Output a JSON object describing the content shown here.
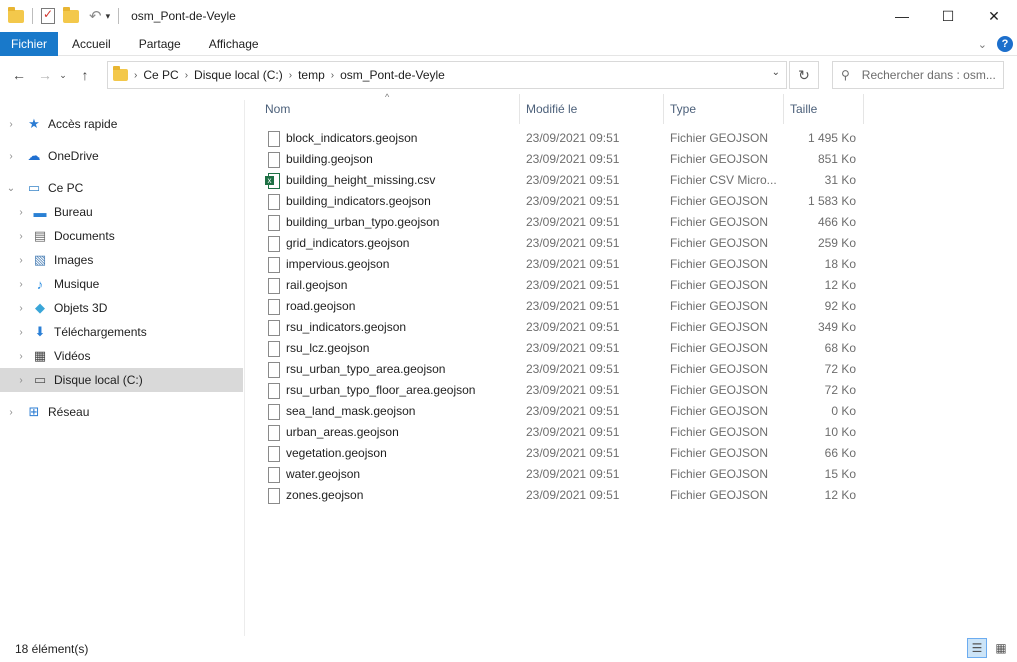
{
  "window": {
    "title": "osm_Pont-de-Veyle",
    "minimize": "—",
    "maximize": "☐",
    "close": "✕"
  },
  "ribbon": {
    "tabs": [
      "Fichier",
      "Accueil",
      "Partage",
      "Affichage"
    ],
    "help": "?"
  },
  "address": {
    "crumbs": [
      "Ce PC",
      "Disque local (C:)",
      "temp",
      "osm_Pont-de-Veyle"
    ],
    "search_placeholder": "Rechercher dans : osm..."
  },
  "nav": [
    {
      "label": "Accès rapide",
      "icon": "star-icon",
      "level": 0
    },
    {
      "label": "OneDrive",
      "icon": "cloud-icon",
      "level": 0
    },
    {
      "label": "Ce PC",
      "icon": "computer-icon",
      "level": 0,
      "expanded": true
    },
    {
      "label": "Bureau",
      "icon": "desktop-icon",
      "level": 1
    },
    {
      "label": "Documents",
      "icon": "documents-icon",
      "level": 1
    },
    {
      "label": "Images",
      "icon": "images-icon",
      "level": 1
    },
    {
      "label": "Musique",
      "icon": "music-icon",
      "level": 1
    },
    {
      "label": "Objets 3D",
      "icon": "cube-icon",
      "level": 1
    },
    {
      "label": "Téléchargements",
      "icon": "download-icon",
      "level": 1
    },
    {
      "label": "Vidéos",
      "icon": "video-icon",
      "level": 1
    },
    {
      "label": "Disque local (C:)",
      "icon": "drive-icon",
      "level": 1,
      "selected": true
    },
    {
      "label": "Réseau",
      "icon": "network-icon",
      "level": 0
    }
  ],
  "columns": {
    "name": "Nom",
    "modified": "Modifié le",
    "type": "Type",
    "size": "Taille"
  },
  "files": [
    {
      "name": "block_indicators.geojson",
      "modified": "23/09/2021 09:51",
      "type": "Fichier GEOJSON",
      "size": "1 495 Ko",
      "kind": "file"
    },
    {
      "name": "building.geojson",
      "modified": "23/09/2021 09:51",
      "type": "Fichier GEOJSON",
      "size": "851 Ko",
      "kind": "file"
    },
    {
      "name": "building_height_missing.csv",
      "modified": "23/09/2021 09:51",
      "type": "Fichier CSV Micro...",
      "size": "31 Ko",
      "kind": "csv"
    },
    {
      "name": "building_indicators.geojson",
      "modified": "23/09/2021 09:51",
      "type": "Fichier GEOJSON",
      "size": "1 583 Ko",
      "kind": "file"
    },
    {
      "name": "building_urban_typo.geojson",
      "modified": "23/09/2021 09:51",
      "type": "Fichier GEOJSON",
      "size": "466 Ko",
      "kind": "file"
    },
    {
      "name": "grid_indicators.geojson",
      "modified": "23/09/2021 09:51",
      "type": "Fichier GEOJSON",
      "size": "259 Ko",
      "kind": "file"
    },
    {
      "name": "impervious.geojson",
      "modified": "23/09/2021 09:51",
      "type": "Fichier GEOJSON",
      "size": "18 Ko",
      "kind": "file"
    },
    {
      "name": "rail.geojson",
      "modified": "23/09/2021 09:51",
      "type": "Fichier GEOJSON",
      "size": "12 Ko",
      "kind": "file"
    },
    {
      "name": "road.geojson",
      "modified": "23/09/2021 09:51",
      "type": "Fichier GEOJSON",
      "size": "92 Ko",
      "kind": "file"
    },
    {
      "name": "rsu_indicators.geojson",
      "modified": "23/09/2021 09:51",
      "type": "Fichier GEOJSON",
      "size": "349 Ko",
      "kind": "file"
    },
    {
      "name": "rsu_lcz.geojson",
      "modified": "23/09/2021 09:51",
      "type": "Fichier GEOJSON",
      "size": "68 Ko",
      "kind": "file"
    },
    {
      "name": "rsu_urban_typo_area.geojson",
      "modified": "23/09/2021 09:51",
      "type": "Fichier GEOJSON",
      "size": "72 Ko",
      "kind": "file"
    },
    {
      "name": "rsu_urban_typo_floor_area.geojson",
      "modified": "23/09/2021 09:51",
      "type": "Fichier GEOJSON",
      "size": "72 Ko",
      "kind": "file"
    },
    {
      "name": "sea_land_mask.geojson",
      "modified": "23/09/2021 09:51",
      "type": "Fichier GEOJSON",
      "size": "0 Ko",
      "kind": "file"
    },
    {
      "name": "urban_areas.geojson",
      "modified": "23/09/2021 09:51",
      "type": "Fichier GEOJSON",
      "size": "10 Ko",
      "kind": "file"
    },
    {
      "name": "vegetation.geojson",
      "modified": "23/09/2021 09:51",
      "type": "Fichier GEOJSON",
      "size": "66 Ko",
      "kind": "file"
    },
    {
      "name": "water.geojson",
      "modified": "23/09/2021 09:51",
      "type": "Fichier GEOJSON",
      "size": "15 Ko",
      "kind": "file"
    },
    {
      "name": "zones.geojson",
      "modified": "23/09/2021 09:51",
      "type": "Fichier GEOJSON",
      "size": "12 Ko",
      "kind": "file"
    }
  ],
  "status": {
    "count": "18 élément(s)"
  },
  "colors": {
    "accent": "#1979ca",
    "selected_nav": "#d9d9d9",
    "header_text": "#4c607a"
  }
}
